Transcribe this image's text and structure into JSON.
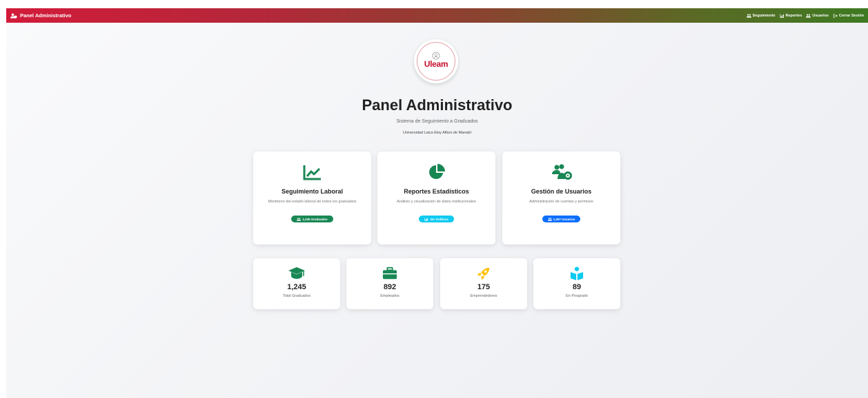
{
  "navbar": {
    "brand": "Panel Administrativo",
    "links": [
      {
        "label": "Seguimiento",
        "icon": "users-icon"
      },
      {
        "label": "Reportes",
        "icon": "chart-bar-icon"
      },
      {
        "label": "Usuarios",
        "icon": "users-icon"
      },
      {
        "label": "Cerrar Sesión",
        "icon": "sign-out-icon"
      }
    ]
  },
  "logo": {
    "text": "Uleam"
  },
  "header": {
    "title": "Panel Administrativo",
    "subtitle": "Sistema de Seguimiento a Graduados",
    "university": "Universidad Laica Eloy Alfaro de Manabí"
  },
  "cards": [
    {
      "title": "Seguimiento Laboral",
      "description": "Monitoreo del estado laboral de todos los graduados",
      "badge": "1,245 Graduados",
      "icon": "chart-line-icon",
      "color": "#198754"
    },
    {
      "title": "Reportes Estadísticos",
      "description": "Análisis y visualización de datos institucionales",
      "badge": "Ver Gráficos",
      "icon": "chart-pie-icon",
      "color": "#0dcaf0"
    },
    {
      "title": "Gestión de Usuarios",
      "description": "Administración de cuentas y permisos",
      "badge": "1,267 Usuarios",
      "icon": "users-cog-icon",
      "color": "#0d6efd"
    }
  ],
  "stats": [
    {
      "value": "1,245",
      "label": "Total Graduados",
      "icon": "graduation-cap-icon",
      "color": "#198754"
    },
    {
      "value": "892",
      "label": "Empleados",
      "icon": "briefcase-icon",
      "color": "#198754"
    },
    {
      "value": "175",
      "label": "Emprendedores",
      "icon": "rocket-icon",
      "color": "#ffc107"
    },
    {
      "value": "89",
      "label": "En Posgrado",
      "icon": "book-reader-icon",
      "color": "#0dcaf0"
    }
  ]
}
